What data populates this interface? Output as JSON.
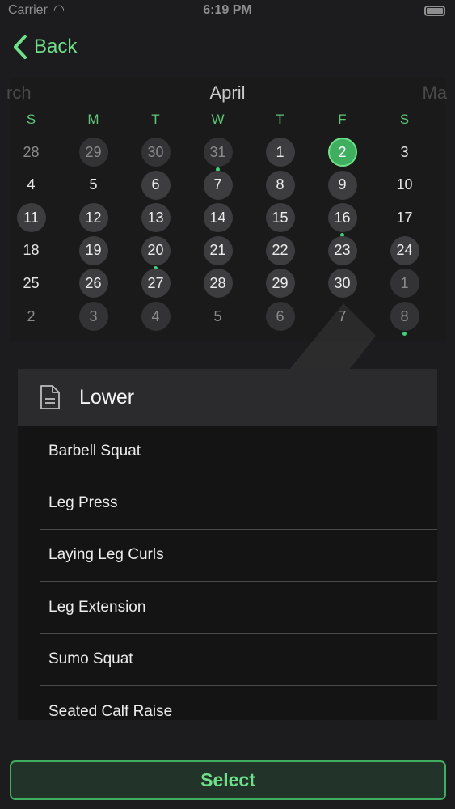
{
  "status_bar": {
    "carrier": "Carrier",
    "time": "6:19 PM"
  },
  "nav": {
    "back_label": "Back"
  },
  "calendar": {
    "prev_month": "rch",
    "current_month": "April",
    "next_month": "Ma",
    "weekdays": [
      "S",
      "M",
      "T",
      "W",
      "T",
      "F",
      "S"
    ],
    "weeks": [
      [
        {
          "day": "28",
          "out": true,
          "filled": false,
          "dot": false
        },
        {
          "day": "29",
          "out": true,
          "filled": true,
          "dot": false
        },
        {
          "day": "30",
          "out": true,
          "filled": true,
          "dot": false
        },
        {
          "day": "31",
          "out": true,
          "filled": true,
          "dot": true
        },
        {
          "day": "1",
          "out": false,
          "filled": true,
          "dot": false
        },
        {
          "day": "2",
          "out": false,
          "filled": true,
          "selected": true,
          "dot": false
        },
        {
          "day": "3",
          "out": false,
          "filled": false,
          "dot": false
        }
      ],
      [
        {
          "day": "4",
          "out": false,
          "filled": false,
          "dot": false
        },
        {
          "day": "5",
          "out": false,
          "filled": false,
          "dot": false
        },
        {
          "day": "6",
          "out": false,
          "filled": true,
          "dot": false
        },
        {
          "day": "7",
          "out": false,
          "filled": true,
          "dot": false
        },
        {
          "day": "8",
          "out": false,
          "filled": true,
          "dot": false
        },
        {
          "day": "9",
          "out": false,
          "filled": true,
          "dot": false
        },
        {
          "day": "10",
          "out": false,
          "filled": false,
          "dot": false
        }
      ],
      [
        {
          "day": "11",
          "out": false,
          "filled": true,
          "dot": false
        },
        {
          "day": "12",
          "out": false,
          "filled": true,
          "dot": false
        },
        {
          "day": "13",
          "out": false,
          "filled": true,
          "dot": false
        },
        {
          "day": "14",
          "out": false,
          "filled": true,
          "dot": false
        },
        {
          "day": "15",
          "out": false,
          "filled": true,
          "dot": false
        },
        {
          "day": "16",
          "out": false,
          "filled": true,
          "dot": true
        },
        {
          "day": "17",
          "out": false,
          "filled": false,
          "dot": false
        }
      ],
      [
        {
          "day": "18",
          "out": false,
          "filled": false,
          "dot": false
        },
        {
          "day": "19",
          "out": false,
          "filled": true,
          "dot": false
        },
        {
          "day": "20",
          "out": false,
          "filled": true,
          "dot": true
        },
        {
          "day": "21",
          "out": false,
          "filled": true,
          "dot": false
        },
        {
          "day": "22",
          "out": false,
          "filled": true,
          "dot": false
        },
        {
          "day": "23",
          "out": false,
          "filled": true,
          "dot": false
        },
        {
          "day": "24",
          "out": false,
          "filled": true,
          "dot": false
        }
      ],
      [
        {
          "day": "25",
          "out": false,
          "filled": false,
          "dot": false
        },
        {
          "day": "26",
          "out": false,
          "filled": true,
          "dot": false
        },
        {
          "day": "27",
          "out": false,
          "filled": true,
          "dot": false
        },
        {
          "day": "28",
          "out": false,
          "filled": true,
          "dot": false
        },
        {
          "day": "29",
          "out": false,
          "filled": true,
          "dot": false
        },
        {
          "day": "30",
          "out": false,
          "filled": true,
          "dot": false
        },
        {
          "day": "1",
          "out": true,
          "filled": true,
          "dot": false
        }
      ],
      [
        {
          "day": "2",
          "out": true,
          "filled": false,
          "dot": false
        },
        {
          "day": "3",
          "out": true,
          "filled": true,
          "dot": false
        },
        {
          "day": "4",
          "out": true,
          "filled": true,
          "dot": false
        },
        {
          "day": "5",
          "out": true,
          "filled": false,
          "dot": false
        },
        {
          "day": "6",
          "out": true,
          "filled": true,
          "dot": false
        },
        {
          "day": "7",
          "out": true,
          "filled": false,
          "dot": false
        },
        {
          "day": "8",
          "out": true,
          "filled": true,
          "dot": true
        }
      ]
    ]
  },
  "workout": {
    "title": "Lower",
    "icon": "document-icon",
    "exercises": [
      "Barbell Squat",
      "Leg Press",
      "Laying Leg Curls",
      "Leg Extension",
      "Sumo Squat",
      "Seated Calf Raise"
    ]
  },
  "actions": {
    "select_label": "Select"
  },
  "colors": {
    "accent": "#6ee08a",
    "selected_day": "#3fae5e",
    "background": "#1c1c1e",
    "day_fill": "#3d3d3f"
  }
}
